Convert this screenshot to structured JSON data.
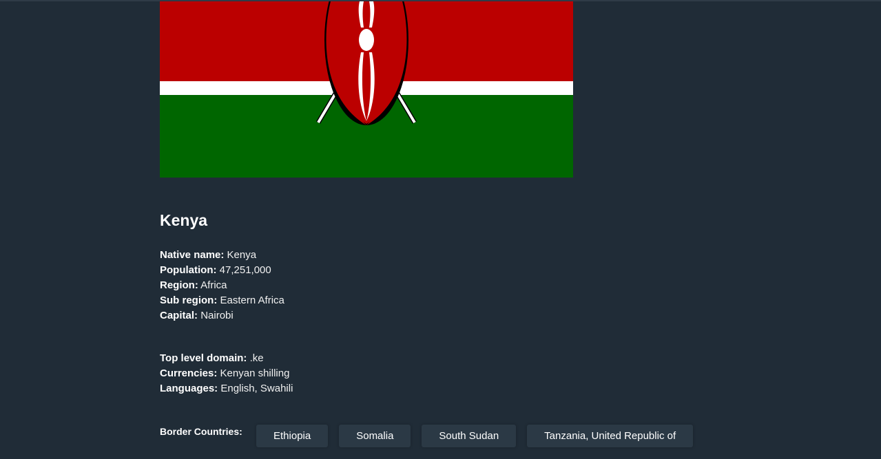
{
  "country": {
    "name": "Kenya",
    "flag": {
      "icon": "kenya-flag",
      "colors": {
        "red": "#bb0000",
        "white": "#ffffff",
        "green": "#006600",
        "black": "#000000"
      }
    },
    "primary_info": [
      {
        "label": "Native name:",
        "value": "Kenya"
      },
      {
        "label": "Population:",
        "value": "47,251,000"
      },
      {
        "label": "Region:",
        "value": "Africa"
      },
      {
        "label": "Sub region:",
        "value": "Eastern Africa"
      },
      {
        "label": "Capital:",
        "value": "Nairobi"
      }
    ],
    "secondary_info": [
      {
        "label": "Top level domain:",
        "value": ".ke"
      },
      {
        "label": "Currencies:",
        "value": "Kenyan shilling"
      },
      {
        "label": "Languages:",
        "value": "English, Swahili"
      }
    ],
    "border_label": "Border Countries:",
    "borders": [
      "Ethiopia",
      "Somalia",
      "South Sudan",
      "Tanzania, United Republic of"
    ]
  },
  "theme": {
    "background": "#202c37",
    "chip_background": "#2b3945",
    "text": "#ffffff"
  }
}
